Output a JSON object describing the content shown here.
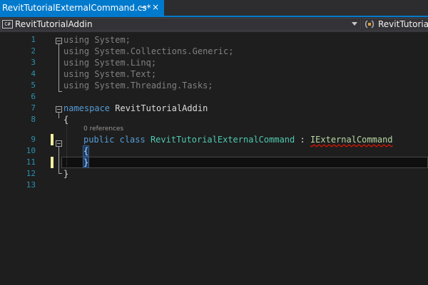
{
  "tab": {
    "title": "RevitTutorialExternalCommand.cs*",
    "pin_glyph": "⊸",
    "close_glyph": "×"
  },
  "navbar": {
    "project_badge": "C#",
    "project_name": "RevitTutorialAddin",
    "class_name": "RevitTutorialAddin"
  },
  "editor": {
    "line_numbers": [
      "1",
      "2",
      "3",
      "4",
      "5",
      "6",
      "7",
      "8",
      "9",
      "10",
      "11",
      "12",
      "13"
    ],
    "codelens": "0 references",
    "lines": {
      "l1_kw": "using",
      "l1_rest": " System;",
      "l2_kw": "using",
      "l2_rest": " System.Collections.Generic;",
      "l3_kw": "using",
      "l3_rest": " System.Linq;",
      "l4_kw": "using",
      "l4_rest": " System.Text;",
      "l5_kw": "using",
      "l5_rest": " System.Threading.Tasks;",
      "l7_kw": "namespace",
      "l7_rest": " RevitTutorialAddin",
      "l8": "{",
      "l9_public": "public",
      "l9_class": "class",
      "l9_name": "RevitTutorialExternalCommand",
      "l9_colon": " : ",
      "l9_iface": "IExternalCommand",
      "l10": "{",
      "l11": "}",
      "l12": "}"
    }
  },
  "colors": {
    "accent": "#007acc",
    "keyword": "#569cd6",
    "type": "#4ec9b0",
    "line_number": "#2b91af",
    "error_squiggle": "#e51400"
  }
}
